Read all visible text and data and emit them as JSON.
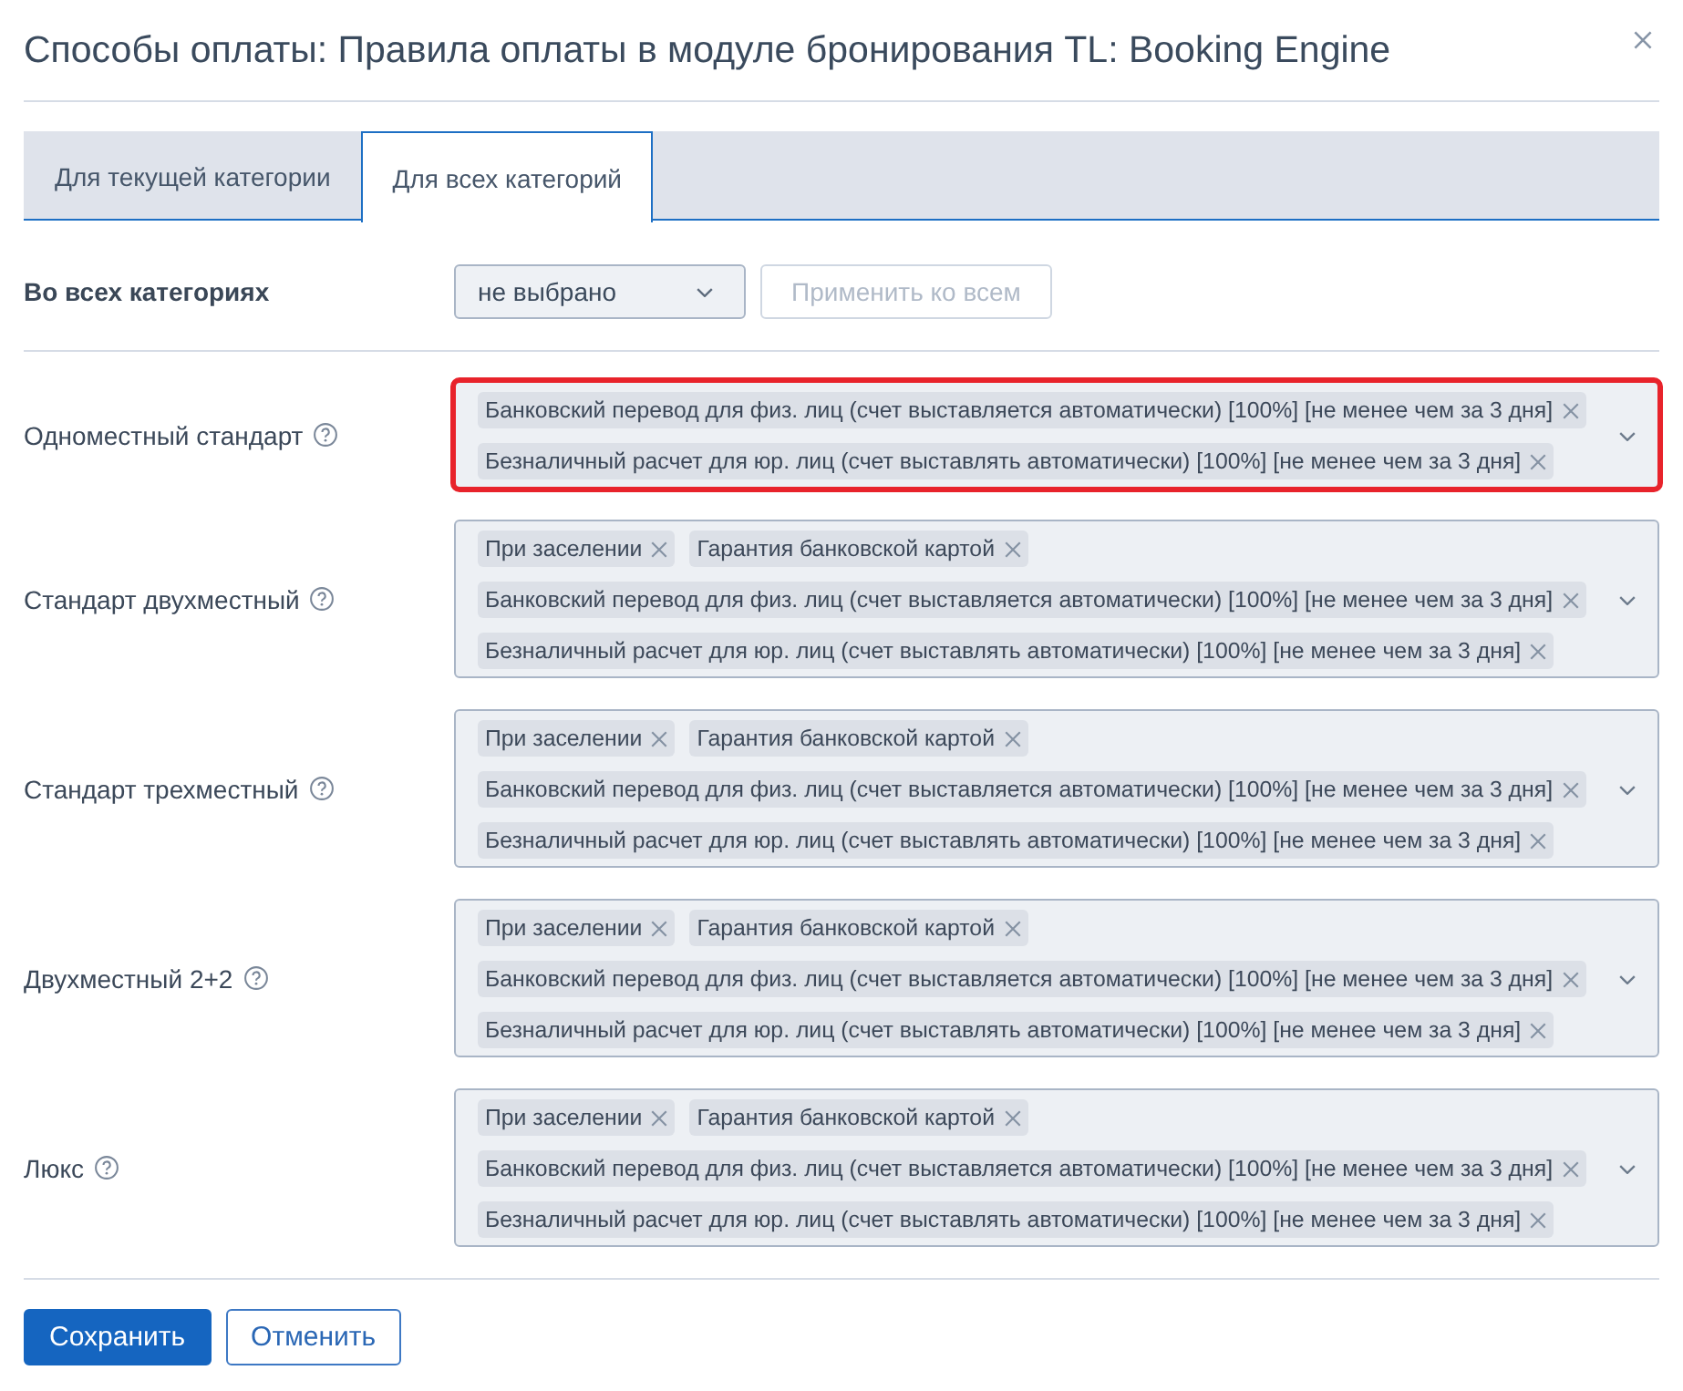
{
  "dialog": {
    "title": "Способы оплаты: Правила оплаты в модуле бронирования TL: Booking Engine"
  },
  "tabs": [
    {
      "label": "Для текущей категории",
      "selected": false
    },
    {
      "label": "Для всех категорий",
      "selected": true
    }
  ],
  "bulk_row": {
    "label": "Во всех категориях",
    "select": {
      "value": "не выбрано"
    },
    "apply_button": {
      "label": "Применить ко всем",
      "disabled": true
    }
  },
  "categories": [
    {
      "name": "Одноместный стандарт",
      "highlighted": true,
      "tags": [
        "Банковский перевод для физ. лиц (счет выставляется автоматически) [100%] [не менее чем за 3 дня]",
        "Безналичный расчет для юр. лиц (счет выставлять автоматически) [100%] [не менее чем за 3 дня]"
      ]
    },
    {
      "name": "Стандарт двухместный",
      "highlighted": false,
      "tags": [
        "При заселении",
        "Гарантия банковской картой",
        "Банковский перевод для физ. лиц (счет выставляется автоматически) [100%] [не менее чем за 3 дня]",
        "Безналичный расчет для юр. лиц (счет выставлять автоматически) [100%] [не менее чем за 3 дня]"
      ]
    },
    {
      "name": "Стандарт трехместный",
      "highlighted": false,
      "tags": [
        "При заселении",
        "Гарантия банковской картой",
        "Банковский перевод для физ. лиц (счет выставляется автоматически) [100%] [не менее чем за 3 дня]",
        "Безналичный расчет для юр. лиц (счет выставлять автоматически) [100%] [не менее чем за 3 дня]"
      ]
    },
    {
      "name": "Двухместный 2+2",
      "highlighted": false,
      "tags": [
        "При заселении",
        "Гарантия банковской картой",
        "Банковский перевод для физ. лиц (счет выставляется автоматически) [100%] [не менее чем за 3 дня]",
        "Безналичный расчет для юр. лиц (счет выставлять автоматически) [100%] [не менее чем за 3 дня]"
      ]
    },
    {
      "name": "Люкс",
      "highlighted": false,
      "tags": [
        "При заселении",
        "Гарантия банковской картой",
        "Банковский перевод для физ. лиц (счет выставляется автоматически) [100%] [не менее чем за 3 дня]",
        "Безналичный расчет для юр. лиц (счет выставлять автоматически) [100%] [не менее чем за 3 дня]"
      ]
    }
  ],
  "footer_buttons": [
    {
      "label": "Сохранить",
      "kind": "primary"
    },
    {
      "label": "Отменить",
      "kind": "secondary"
    }
  ]
}
